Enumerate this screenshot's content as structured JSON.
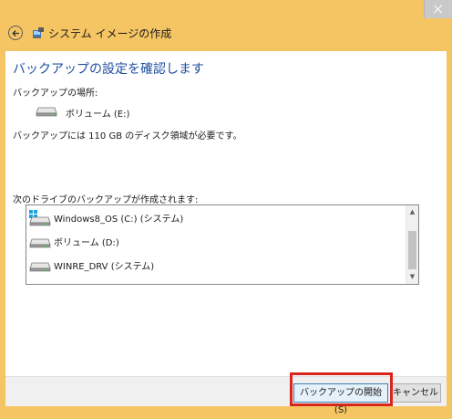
{
  "window": {
    "title": "システム イメージの作成"
  },
  "main": {
    "heading": "バックアップの設定を確認します",
    "location_label": "バックアップの場所:",
    "location_value": "ボリューム (E:)",
    "space_message": "バックアップには 110 GB のディスク領域が必要です。",
    "drives_label": "次のドライブのバックアップが作成されます:",
    "drives": [
      {
        "label": "Windows8_OS (C:) (システム)",
        "icon": "windows-drive-icon"
      },
      {
        "label": "ボリューム (D:)",
        "icon": "hard-drive-icon"
      },
      {
        "label": "WINRE_DRV (システム)",
        "icon": "hard-drive-icon"
      }
    ]
  },
  "footer": {
    "start_label": "バックアップの開始(S)",
    "cancel_label": "キャンセル"
  },
  "colors": {
    "frame": "#f5c563",
    "heading": "#1e4ea1",
    "highlight": "#d9261c"
  }
}
